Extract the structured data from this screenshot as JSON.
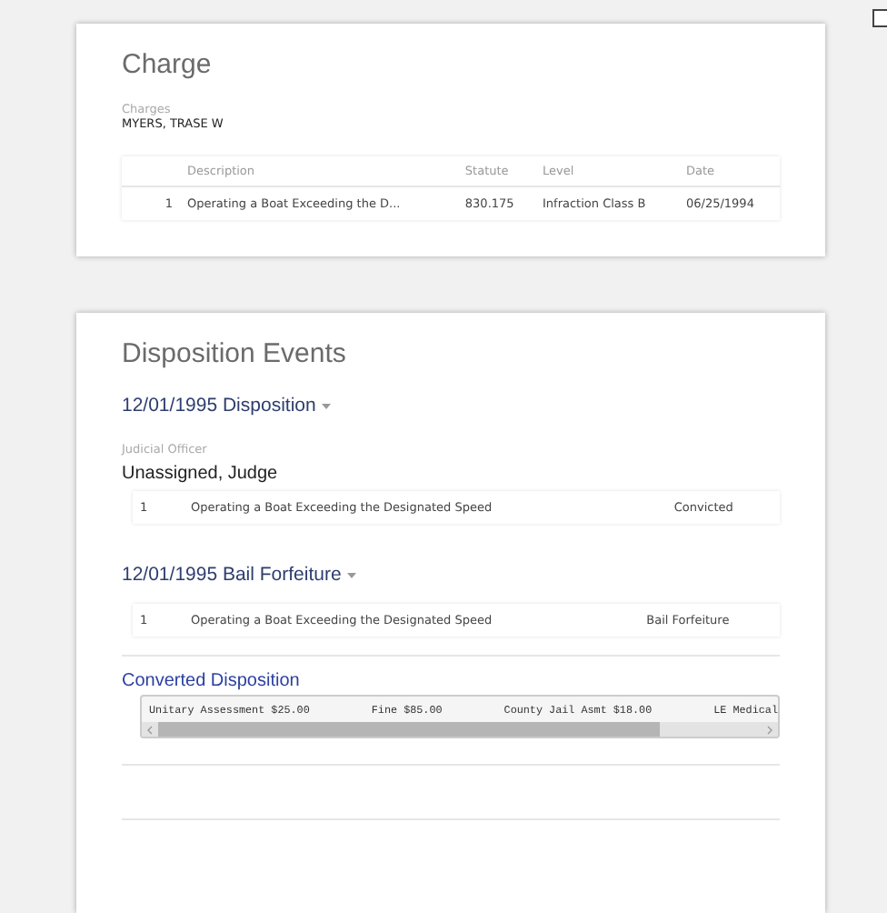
{
  "charge": {
    "title": "Charge",
    "charges_label": "Charges",
    "party": "MYERS, TRASE W",
    "table": {
      "columns": [
        "Description",
        "Statute",
        "Level",
        "Date"
      ],
      "rows": [
        {
          "number": "1",
          "description": "Operating a Boat Exceeding the D...",
          "statute": "830.175",
          "offense_level": "Infraction Class B",
          "date": "06/25/1994"
        }
      ]
    }
  },
  "disposition_events": {
    "title": "Disposition Events",
    "events": [
      {
        "heading": "12/01/1995 Disposition",
        "officer_label": "Judicial Officer",
        "officer": "Unassigned, Judge",
        "rows": [
          {
            "number": "1",
            "description": "Operating a Boat Exceeding the Designated Speed",
            "result": "Convicted"
          }
        ]
      },
      {
        "heading": "12/01/1995 Bail Forfeiture",
        "rows": [
          {
            "number": "1",
            "description": "Operating a Boat Exceeding the Designated Speed",
            "result": "Bail Forfeiture"
          }
        ]
      }
    ],
    "converted": {
      "title": "Converted Disposition",
      "items": [
        "Unitary Assessment $25.00",
        "Fine $85.00",
        "County Jail Asmt $18.00",
        "LE Medical"
      ]
    }
  }
}
